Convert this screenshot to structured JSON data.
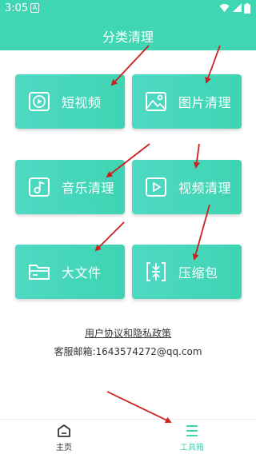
{
  "status_bar": {
    "time": "3:05",
    "notification_letter": "A"
  },
  "header": {
    "title": "分类清理"
  },
  "cards": [
    {
      "label": "短视频",
      "icon": "play-video-icon"
    },
    {
      "label": "图片清理",
      "icon": "image-icon"
    },
    {
      "label": "音乐清理",
      "icon": "music-note-icon"
    },
    {
      "label": "视频清理",
      "icon": "video-play-icon"
    },
    {
      "label": "大文件",
      "icon": "folder-icon"
    },
    {
      "label": "压缩包",
      "icon": "compress-icon"
    }
  ],
  "footer": {
    "agreement": "用户协议和隐私政策",
    "contact": "客服邮箱:1643574272@qq.com"
  },
  "navbar": {
    "items": [
      {
        "label": "主页",
        "icon": "home-icon",
        "active": false
      },
      {
        "label": "工具箱",
        "icon": "toolbox-list-icon",
        "active": true
      }
    ]
  },
  "colors": {
    "accent": "#3fd6b4",
    "annotation_arrow": "#cc1f1f"
  }
}
